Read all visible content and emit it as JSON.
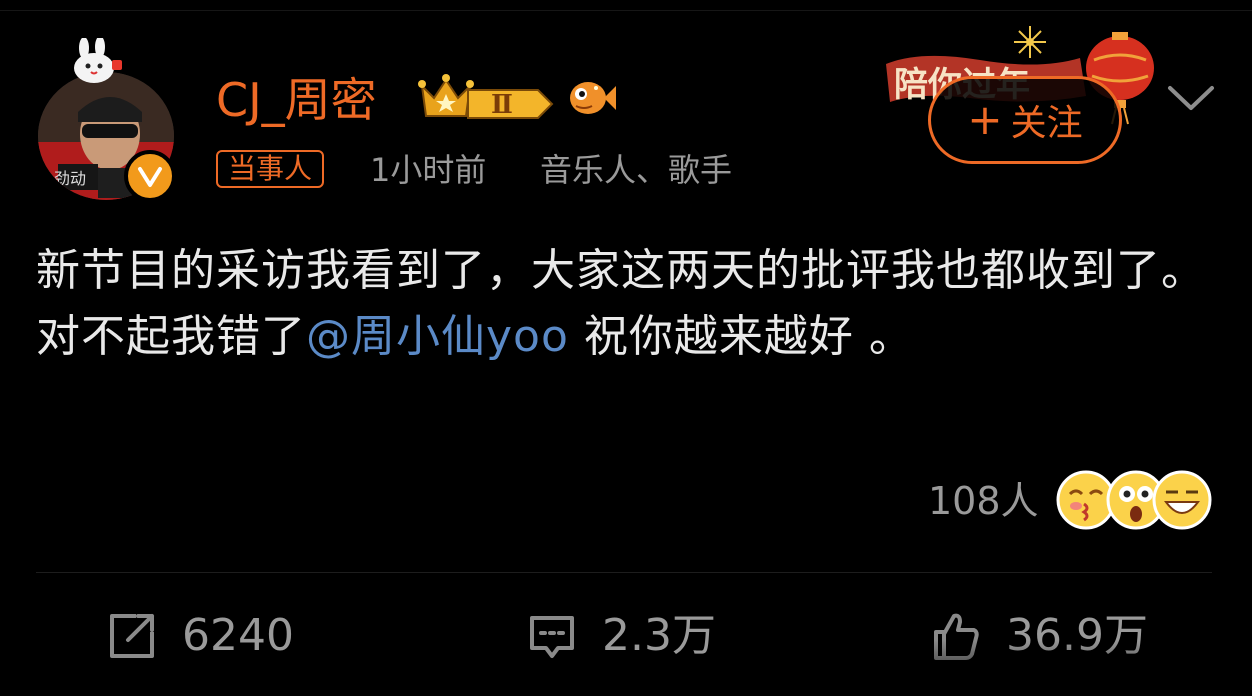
{
  "post": {
    "author": {
      "name": "CJ_周密",
      "badge": "当事人",
      "time": "1小时前",
      "profession": "音乐人、歌手",
      "vip_level": "Ⅱ",
      "avatar_text": "劲动"
    },
    "follow_label": "关注",
    "follow_plus": "+",
    "banner_text": "陪你过年",
    "text_part1": "新节目的采访我看到了，大家这两天的批评我也都收到了。对不起我错了",
    "mention": "@周小仙yoo",
    "text_part2": " 祝你越来越好 。",
    "reactions": {
      "count": "108人",
      "emojis": [
        "kiss-emoji",
        "shocked-emoji",
        "grin-emoji"
      ]
    }
  },
  "actions": {
    "repost": "6240",
    "comments": "2.3万",
    "likes": "36.9万"
  },
  "colors": {
    "accent": "#ee6a26",
    "mention": "#5b8ac7",
    "muted": "#9a9a9a",
    "background": "#000000"
  }
}
